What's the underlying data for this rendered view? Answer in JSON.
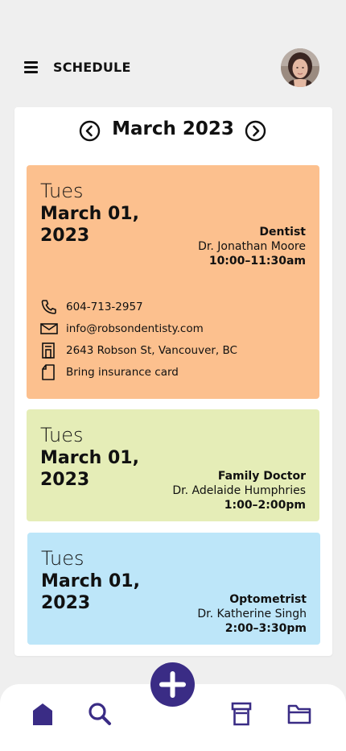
{
  "header": {
    "title": "SCHEDULE"
  },
  "month_nav": {
    "label": "March 2023"
  },
  "appointments": [
    {
      "day": "Tues",
      "date": "March 01, 2023",
      "type": "Dentist",
      "doctor": "Dr. Jonathan Moore",
      "time": "10:00–11:30am",
      "color": "#fcc08e",
      "phone": "604-713-2957",
      "email": "info@robsondentisty.com",
      "address": "2643 Robson St, Vancouver, BC",
      "note": "Bring insurance card"
    },
    {
      "day": "Tues",
      "date": "March 01, 2023",
      "type": "Family Doctor",
      "doctor": "Dr. Adelaide Humphries",
      "time": "1:00–2:00pm",
      "color": "#e5edb7"
    },
    {
      "day": "Tues",
      "date": "March 01, 2023",
      "type": "Optometrist",
      "doctor": "Dr. Katherine Singh",
      "time": "2:00–3:30pm",
      "color": "#bde6f9"
    }
  ],
  "colors": {
    "accent": "#3a2c85",
    "background": "#efefef"
  },
  "icons": {
    "menu": "hamburger-icon",
    "prev": "chevron-left-circle-icon",
    "next": "chevron-right-circle-icon",
    "phone": "phone-icon",
    "email": "mail-icon",
    "address": "building-icon",
    "note": "note-icon",
    "home": "home-icon",
    "search": "search-icon",
    "add": "plus-circle-icon",
    "pill": "pill-bottle-icon",
    "folder": "folder-icon"
  }
}
